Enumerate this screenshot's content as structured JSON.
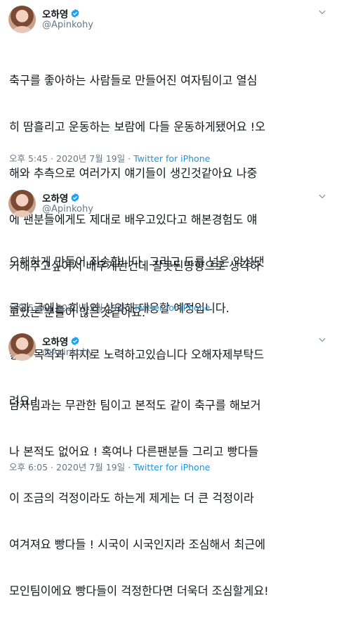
{
  "tweets": [
    {
      "display_name": "오하영",
      "handle": "@Apinkohy",
      "lines": [
        "축구를 좋아하는 사람들로 만들어진 여자팀이고 열심",
        "히 땀흘리고 운동하는 보람에 다들 운동하게됐어요 !오",
        "해와 추측으로 여러가지 얘기들이 생긴것같아요 나중",
        "에 팬분들에게도 제대로 배우고있다고 해본경험도 얘",
        "기해주고싶어서 배우게된건데 잘못된방향으로 생각하",
        "고있는 분들이 많은것같아요."
      ],
      "time": "오후 5:45",
      "date": "2020년 7월 19일",
      "source": "Twitter for iPhone"
    },
    {
      "display_name": "오하영",
      "handle": "@Apinkohy",
      "lines": [
        "오해하게 만들어 죄송합니다. 그리고 도를 넘은 악성댓",
        "글과 글에는 회사와 상의해 대응할 예정입니다.",
        "좋은 목적과 취지로 노력하고있습니다 오해자제부탁드",
        "려요.!"
      ],
      "time": "오후 5:46",
      "date": "2020년 7월 19일",
      "source": "Twitter for iPhone"
    },
    {
      "display_name": "오하영",
      "handle": "@Apinkohy",
      "lines": [
        "남자팀과는 무관한 팀이고 본적도 같이 축구를 해보거",
        "나 본적도 없어요 ! 혹여나 다른팬분들 그리고 빵다들",
        "이 조금의 걱정이라도 하는게 제게는 더 큰 걱정이라",
        "여겨져요 빵다들 ! 시국이 시국인지라 조심해서 최근에",
        "모인팀이에요 빵다들이 걱정한다면 더욱더 조심할게요!"
      ],
      "time": "오후 6:05",
      "date": "2020년 7월 19일",
      "source": "Twitter for iPhone"
    }
  ],
  "meta_separator": "·",
  "colors": {
    "verified": "#1da1f2",
    "muted": "#657786",
    "link": "#1b95e0"
  },
  "icons": {
    "verified": "verified-badge-icon",
    "more": "chevron-down-icon"
  }
}
